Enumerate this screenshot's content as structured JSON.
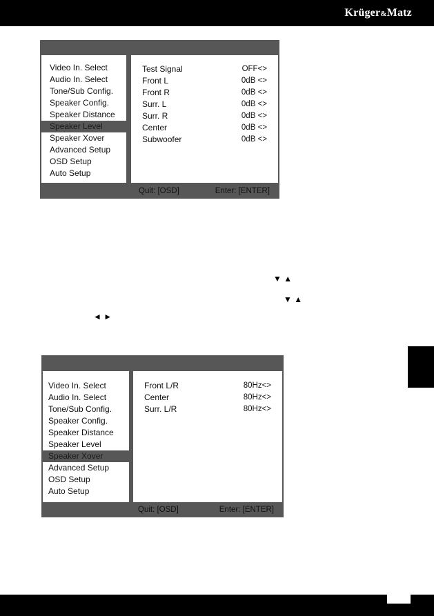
{
  "header": {
    "brand_main": "Krüger",
    "brand_amp": "&",
    "brand_end": "Matz"
  },
  "osd1": {
    "menu": [
      {
        "label": "Video In. Select",
        "selected": false
      },
      {
        "label": "Audio In. Select",
        "selected": false
      },
      {
        "label": "Tone/Sub Config.",
        "selected": false
      },
      {
        "label": "Speaker Config.",
        "selected": false
      },
      {
        "label": "Speaker Distance",
        "selected": false
      },
      {
        "label": "Speaker Level",
        "selected": true
      },
      {
        "label": "Speaker Xover",
        "selected": false
      },
      {
        "label": "Advanced Setup",
        "selected": false
      },
      {
        "label": "OSD Setup",
        "selected": false
      },
      {
        "label": "Auto Setup",
        "selected": false
      }
    ],
    "rows": [
      {
        "label": "Test Signal",
        "value": "OFF<>"
      },
      {
        "label": "Front L",
        "value": "0dB <>"
      },
      {
        "label": "Front R",
        "value": "0dB <>"
      },
      {
        "label": "Surr. L",
        "value": "0dB <>"
      },
      {
        "label": "Surr. R",
        "value": "0dB <>"
      },
      {
        "label": "Center",
        "value": "0dB <>"
      },
      {
        "label": "Subwoofer",
        "value": "0dB <>"
      }
    ],
    "quit": "Quit: [OSD]",
    "enter": "Enter: [ENTER]"
  },
  "arrows": {
    "down_up_1": "▼ ▲",
    "down_up_2": "▼  ▲",
    "left_right": "◄ ►"
  },
  "osd2": {
    "menu": [
      {
        "label": "Video In. Select",
        "selected": false
      },
      {
        "label": "Audio In. Select",
        "selected": false
      },
      {
        "label": "Tone/Sub Config.",
        "selected": false
      },
      {
        "label": "Speaker Config.",
        "selected": false
      },
      {
        "label": "Speaker Distance",
        "selected": false
      },
      {
        "label": "Speaker Level",
        "selected": false
      },
      {
        "label": "Speaker Xover",
        "selected": true
      },
      {
        "label": "Advanced Setup",
        "selected": false
      },
      {
        "label": "OSD Setup",
        "selected": false
      },
      {
        "label": "Auto Setup",
        "selected": false
      }
    ],
    "rows": [
      {
        "label": "Front L/R",
        "value": "80Hz<>"
      },
      {
        "label": "Center",
        "value": "80Hz<>"
      },
      {
        "label": "Surr. L/R",
        "value": "80Hz<>"
      }
    ],
    "quit": "Quit: [OSD]",
    "enter": "Enter: [ENTER]"
  },
  "colors": {
    "osd_frame": "#575757",
    "page_bars": "#000000"
  }
}
